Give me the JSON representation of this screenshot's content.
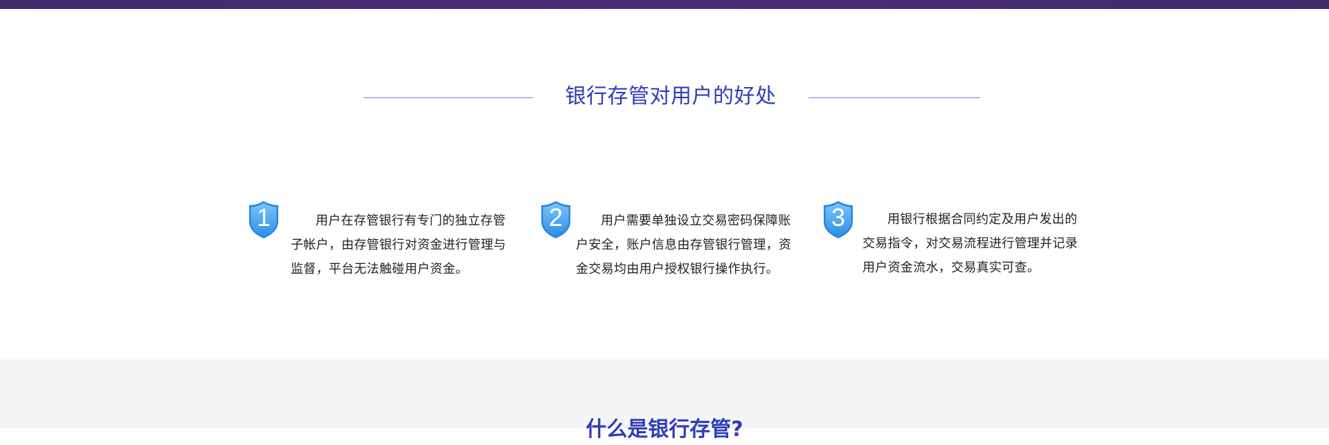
{
  "header": {
    "bar_color": "#4b2e78"
  },
  "section": {
    "title": "银行存管对用户的好处",
    "accent_color": "#2e3db8",
    "line_color": "#6f7be8"
  },
  "benefits": [
    {
      "number": "1",
      "icon": "shield-icon",
      "text": "用户在存管银行有专门的独立存管子帐户，由存管银行对资金进行管理与监督，平台无法触碰用户资金。"
    },
    {
      "number": "2",
      "icon": "shield-icon",
      "text": "用户需要单独设立交易密码保障账户安全，账户信息由存管银行管理，资金交易均由用户授权银行操作执行。"
    },
    {
      "number": "3",
      "icon": "shield-icon",
      "text": "用银行根据合同约定及用户发出的交易指令，对交易流程进行管理并记录用户资金流水，交易真实可查。"
    }
  ],
  "next_section": {
    "title": "什么是银行存管?",
    "background": "#f5f5f5"
  }
}
